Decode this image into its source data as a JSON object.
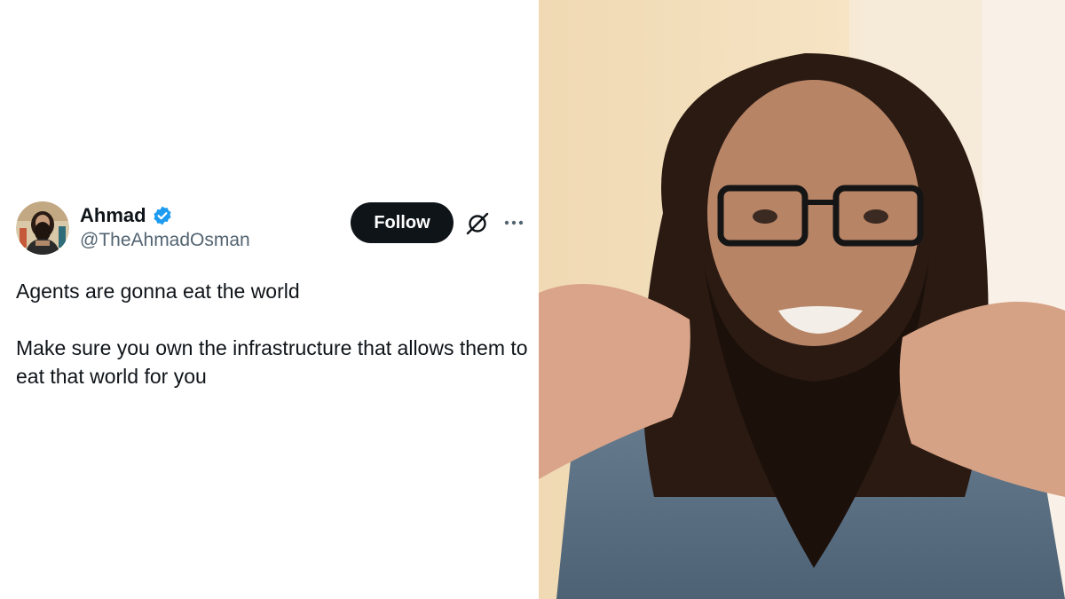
{
  "tweet": {
    "author": {
      "display_name": "Ahmad",
      "handle": "@TheAhmadOsman",
      "verified": true,
      "avatar_icon": "avatar-photo"
    },
    "follow_label": "Follow",
    "icons": {
      "grok": "grok-icon",
      "more": "more-icon"
    },
    "text": [
      "Agents are gonna eat the world",
      "Make sure you own the infrastructure that allows them to eat that world for you"
    ]
  },
  "colors": {
    "verified_blue": "#1d9bf0",
    "follow_bg": "#0f1419",
    "text_primary": "#0f1419",
    "text_secondary": "#536471"
  },
  "video_frame": {
    "description_icon": "video-still"
  }
}
